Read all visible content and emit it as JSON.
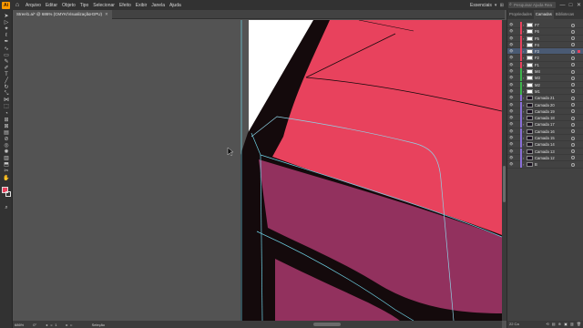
{
  "menubar": {
    "app_logo": "Ai",
    "items": [
      "Arquivo",
      "Editar",
      "Objeto",
      "Tipo",
      "Selecionar",
      "Efeito",
      "Exibir",
      "Janela",
      "Ajuda"
    ],
    "workspace": "Essenciais",
    "search_placeholder": "Pesquisar Ajuda Rea",
    "window_buttons": [
      "—",
      "□",
      "✕"
    ]
  },
  "document_tab": {
    "title": "Streel1.ai* @ 686% (CMYK/Visualização GPU)",
    "close": "✕"
  },
  "statusbar": {
    "zoom": "686%",
    "rotation": "0°",
    "nav": "◂ ◃",
    "page": "1",
    "nav_next": "▸ ▹",
    "mode": "Seleção"
  },
  "layers_panel": {
    "tabs": [
      "Propriedades",
      "Camadas",
      "Bibliotecas"
    ],
    "active_tab": "Camadas",
    "layers": [
      {
        "name": "F7",
        "color": "#e8425d",
        "thumb": "light",
        "selected": false
      },
      {
        "name": "F6",
        "color": "#e8425d",
        "thumb": "light",
        "selected": false
      },
      {
        "name": "F5",
        "color": "#e8425d",
        "thumb": "light",
        "selected": false
      },
      {
        "name": "F4",
        "color": "#e8425d",
        "thumb": "light",
        "selected": false
      },
      {
        "name": "F3",
        "color": "#e8425d",
        "thumb": "light",
        "selected": true
      },
      {
        "name": "F2",
        "color": "#e8425d",
        "thumb": "light",
        "selected": false
      },
      {
        "name": "F1",
        "color": "#e8425d",
        "thumb": "light",
        "selected": false
      },
      {
        "name": "M4",
        "color": "#3cb44b",
        "thumb": "light",
        "selected": false
      },
      {
        "name": "M3",
        "color": "#3cb44b",
        "thumb": "light",
        "selected": false
      },
      {
        "name": "M2",
        "color": "#3cb44b",
        "thumb": "light",
        "selected": false
      },
      {
        "name": "M1",
        "color": "#3cb44b",
        "thumb": "light",
        "selected": false
      },
      {
        "name": "Camada 21",
        "color": "#8a6fd6",
        "thumb": "dark",
        "selected": false
      },
      {
        "name": "Camada 20",
        "color": "#8a6fd6",
        "thumb": "dark",
        "selected": false
      },
      {
        "name": "Camada 19",
        "color": "#8a6fd6",
        "thumb": "dark",
        "selected": false
      },
      {
        "name": "Camada 18",
        "color": "#8a6fd6",
        "thumb": "dark",
        "selected": false
      },
      {
        "name": "Camada 17",
        "color": "#8a6fd6",
        "thumb": "dark",
        "selected": false
      },
      {
        "name": "Camada 16",
        "color": "#8a6fd6",
        "thumb": "dark",
        "selected": false
      },
      {
        "name": "Camada 15",
        "color": "#8a6fd6",
        "thumb": "dark",
        "selected": false
      },
      {
        "name": "Camada 14",
        "color": "#8a6fd6",
        "thumb": "dark",
        "selected": false
      },
      {
        "name": "Camada 13",
        "color": "#8a6fd6",
        "thumb": "dark",
        "selected": false
      },
      {
        "name": "Camada 12",
        "color": "#8a6fd6",
        "thumb": "dark",
        "selected": false
      },
      {
        "name": "B",
        "color": "#8a6fd6",
        "thumb": "dark",
        "selected": false
      }
    ],
    "footer_count": "22 Ca",
    "footer_icons": "⟲ ▤ ⊕ ▣ ▥ 🗑"
  },
  "tools": [
    {
      "name": "selection-tool-icon",
      "glyph": "➤"
    },
    {
      "name": "direct-selection-tool-icon",
      "glyph": "▷"
    },
    {
      "name": "magic-wand-tool-icon",
      "glyph": "✦"
    },
    {
      "name": "lasso-tool-icon",
      "glyph": "ℓ"
    },
    {
      "name": "pen-tool-icon",
      "glyph": "✒"
    },
    {
      "name": "curvature-tool-icon",
      "glyph": "∿"
    },
    {
      "name": "rectangle-tool-icon",
      "glyph": "▭"
    },
    {
      "name": "paintbrush-tool-icon",
      "glyph": "✎"
    },
    {
      "name": "pencil-tool-icon",
      "glyph": "✐"
    },
    {
      "name": "type-tool-icon",
      "glyph": "T"
    },
    {
      "name": "line-tool-icon",
      "glyph": "╱"
    },
    {
      "name": "rotate-tool-icon",
      "glyph": "↻"
    },
    {
      "name": "scale-tool-icon",
      "glyph": "⤡"
    },
    {
      "name": "width-tool-icon",
      "glyph": "⋈"
    },
    {
      "name": "free-transform-tool-icon",
      "glyph": "⬚"
    },
    {
      "name": "shape-builder-tool-icon",
      "glyph": "◔"
    },
    {
      "name": "perspective-grid-tool-icon",
      "glyph": "⊞"
    },
    {
      "name": "mesh-tool-icon",
      "glyph": "⊠"
    },
    {
      "name": "gradient-tool-icon",
      "glyph": "▤"
    },
    {
      "name": "eyedropper-tool-icon",
      "glyph": "⊘"
    },
    {
      "name": "blend-tool-icon",
      "glyph": "◎"
    },
    {
      "name": "symbol-sprayer-tool-icon",
      "glyph": "✺"
    },
    {
      "name": "column-graph-tool-icon",
      "glyph": "▥"
    },
    {
      "name": "artboard-tool-icon",
      "glyph": "⬒"
    },
    {
      "name": "slice-tool-icon",
      "glyph": "✂"
    },
    {
      "name": "hand-tool-icon",
      "glyph": "✋"
    },
    {
      "name": "zoom-tool-icon",
      "glyph": "⌕"
    }
  ],
  "colors": {
    "artwork_pink": "#e8425d",
    "artwork_plum": "#92315e",
    "artwork_outline": "#140a0c",
    "guide_cyan": "#6fd3e6"
  }
}
